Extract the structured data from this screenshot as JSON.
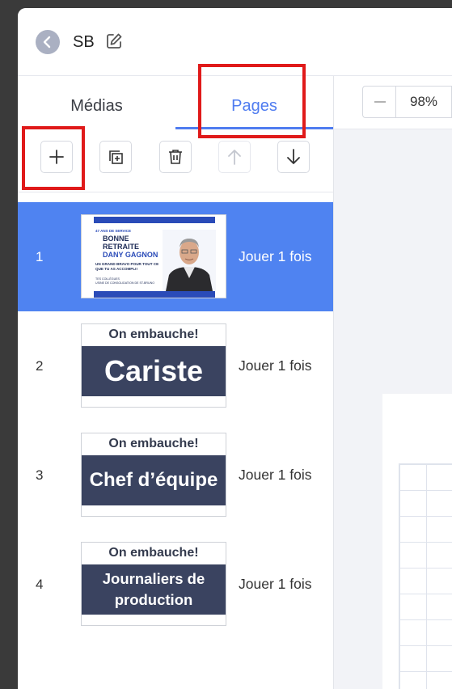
{
  "header": {
    "title": "SB"
  },
  "tabs": [
    {
      "label": "Médias"
    },
    {
      "label": "Pages"
    }
  ],
  "zoom": {
    "value": "98%"
  },
  "toolbar": {
    "buttons": [
      "add-page",
      "duplicate-page",
      "delete-page",
      "move-up",
      "move-down"
    ]
  },
  "pages": [
    {
      "number": "1",
      "play": "Jouer 1 fois",
      "thumb": {
        "eyebrow": "47 ANS DE SERVICE",
        "line1": "BONNE",
        "line2": "RETRAITE",
        "name": "DANY GAGNON",
        "message": "UN GRAND BRAVO POUR TOUT CE QUE TU AS ACCOMPLI!",
        "signature1": "TES COLLÈGUES",
        "signature2": "USINE DE CONSOLIDATION DE ST-BRUNO"
      }
    },
    {
      "number": "2",
      "play": "Jouer 1 fois",
      "thumb": {
        "head": "On embauche!",
        "band": "Cariste"
      }
    },
    {
      "number": "3",
      "play": "Jouer 1 fois",
      "thumb": {
        "head": "On embauche!",
        "band": "Chef d’équipe"
      }
    },
    {
      "number": "4",
      "play": "Jouer 1 fois",
      "thumb": {
        "head": "On embauche!",
        "band": "Journaliers de production"
      }
    }
  ],
  "colors": {
    "accent": "#4f7cf0",
    "selected_row": "#4f83f1",
    "highlight": "#e01a1a",
    "banner": "#3a4360"
  }
}
